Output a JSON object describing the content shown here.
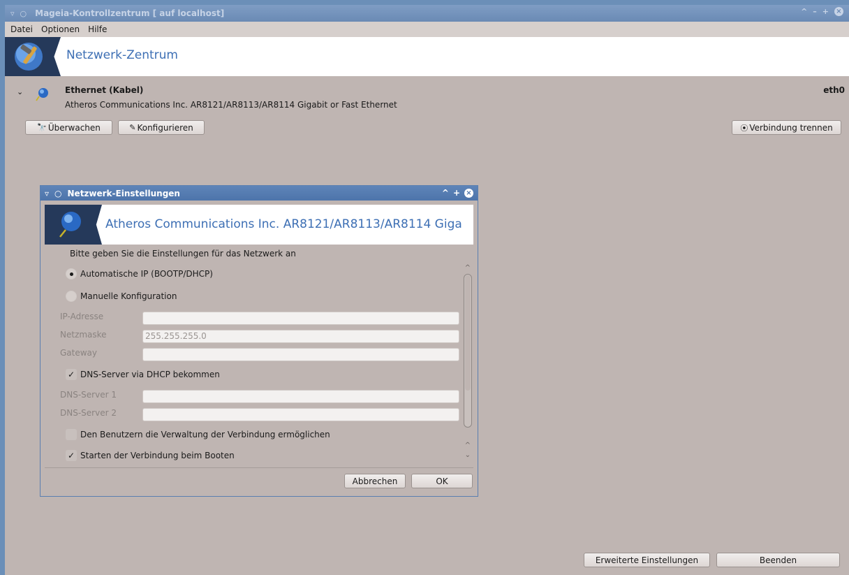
{
  "window": {
    "title": "Mageia-Kontrollzentrum  [ auf localhost]"
  },
  "menu": {
    "items": [
      "Datei",
      "Optionen",
      "Hilfe"
    ]
  },
  "header": {
    "title": "Netzwerk-Zentrum"
  },
  "device": {
    "name": "Ethernet (Kabel)",
    "description": "Atheros Communications Inc. AR8121/AR8113/AR8114 Gigabit or Fast Ethernet",
    "interface": "eth0",
    "buttons": {
      "monitor": "Überwachen",
      "configure": "Konfigurieren",
      "disconnect": "Verbindung trennen"
    }
  },
  "dialog": {
    "title": "Netzwerk-Einstellungen",
    "header_title": "Atheros Communications Inc. AR8121/AR8113/AR8114 Giga",
    "instruction": "Bitte geben Sie die Einstellungen für das Netzwerk an",
    "options": {
      "auto_ip": "Automatische IP (BOOTP/DHCP)",
      "manual": "Manuelle Konfiguration",
      "selected": "auto_ip"
    },
    "fields": {
      "ip_label": "IP-Adresse",
      "ip_value": "",
      "netmask_label": "Netzmaske",
      "netmask_value": "255.255.255.0",
      "gateway_label": "Gateway",
      "gateway_value": "",
      "dns1_label": "DNS-Server 1",
      "dns1_value": "",
      "dns2_label": "DNS-Server 2",
      "dns2_value": ""
    },
    "checkboxes": {
      "dns_dhcp": "DNS-Server via DHCP bekommen",
      "dns_dhcp_checked": true,
      "user_manage": "Den Benutzern die Verwaltung der Verbindung ermöglichen",
      "user_manage_checked": false,
      "start_boot": "Starten der Verbindung beim Booten",
      "start_boot_checked": true
    },
    "buttons": {
      "cancel": "Abbrechen",
      "ok": "OK"
    }
  },
  "footer": {
    "advanced": "Erweiterte Einstellungen",
    "quit": "Beenden"
  }
}
